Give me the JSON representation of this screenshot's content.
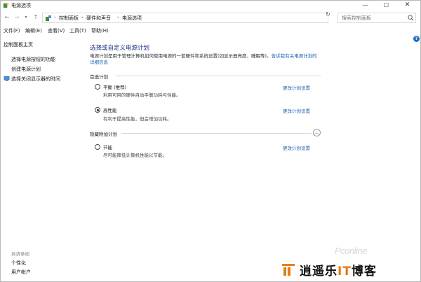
{
  "window": {
    "title": "电源选项",
    "controls": {
      "minimize": "—",
      "maximize": "☐",
      "close": "✕"
    }
  },
  "address_bar": {
    "back": "←",
    "forward": "→",
    "recent": "▾",
    "up": "↑",
    "breadcrumbs": [
      "控制面板",
      "硬件和声音",
      "电源选项"
    ],
    "separator": "›",
    "dropdown": "⌄",
    "refresh": "↻",
    "search_placeholder": "搜索控制面板"
  },
  "menu": {
    "items": [
      "文件(F)",
      "编辑(E)",
      "查看(V)",
      "工具(T)",
      "帮助(H)"
    ]
  },
  "help": "?",
  "sidebar": {
    "items": [
      "控制面板主页",
      "选择电源按钮的功能",
      "创建电源计划",
      "选择关闭显示器的时间"
    ],
    "see_also_title": "另请参阅",
    "see_also": [
      "个性化",
      "用户帐户"
    ]
  },
  "main": {
    "title": "选择或自定义电源计划",
    "description": "电源计划是用于管理计算机如何使用电源的一套硬件和系统设置(如显示器亮度、睡眠等)。",
    "description_link": "告诉我有关电源计划的详细信息",
    "preferred_group": "首选计划",
    "hidden_group": "隐藏附加计划",
    "collapse": "︿",
    "plans": [
      {
        "name": "平衡 (推荐)",
        "description": "利用可用的硬件自动平衡功耗与性能。",
        "link": "更改计划设置",
        "selected": false
      },
      {
        "name": "高性能",
        "description": "有利于提高性能，但会增加功耗。",
        "link": "更改计划设置",
        "selected": true
      },
      {
        "name": "节能",
        "description": "尽可能降低计算机性能以节能。",
        "link": "更改计划设置",
        "selected": false
      }
    ]
  },
  "watermark": {
    "pconline": "Pconline",
    "brand_prefix": "逍遥乐",
    "brand_it": "IT",
    "brand_suffix": "博客"
  },
  "colors": {
    "title_blue": "#1e3287",
    "link_blue": "#1a5fb4",
    "accent_orange": "#e87b16"
  }
}
